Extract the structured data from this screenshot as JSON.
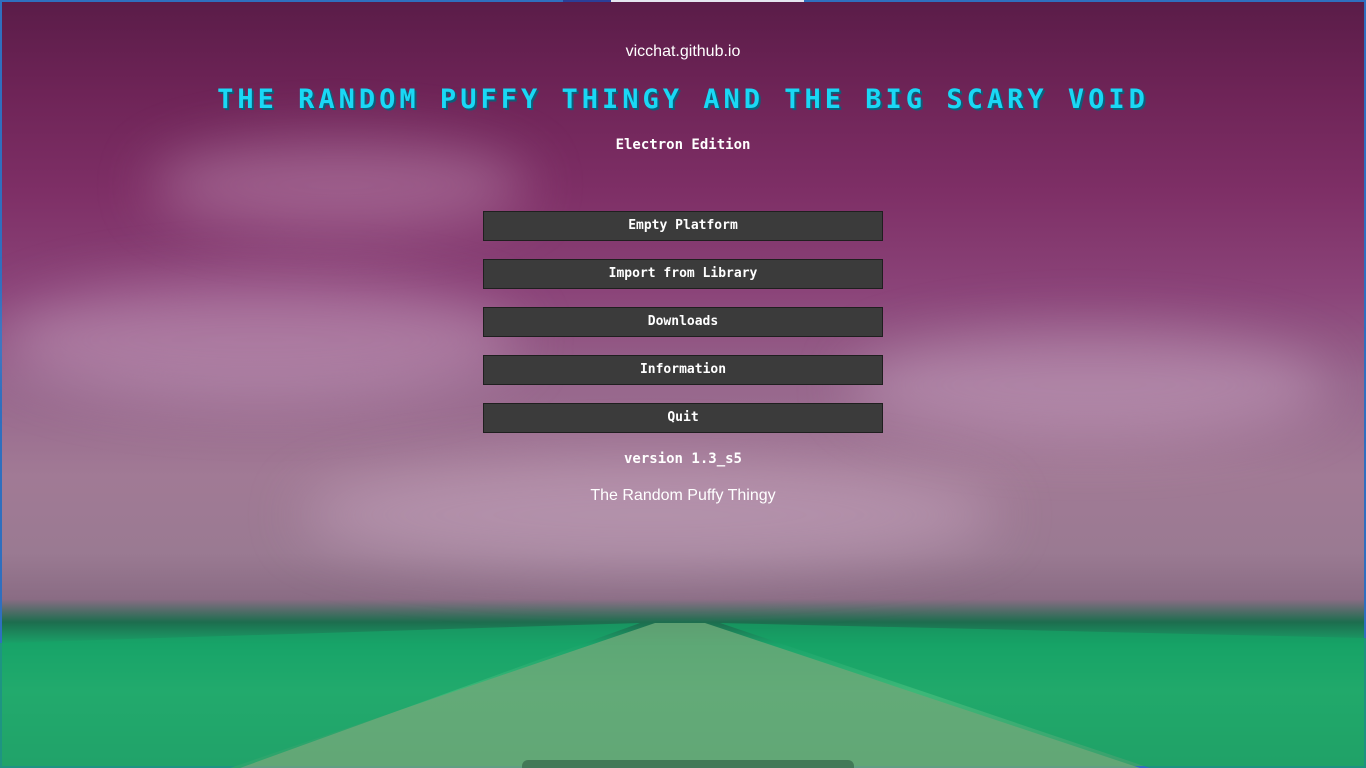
{
  "header": {
    "site": "vicchat.github.io",
    "title": "THE RANDOM PUFFY THINGY AND THE BIG SCARY VOID",
    "subtitle": "Electron Edition"
  },
  "menu": {
    "items": [
      {
        "label": "Empty Platform"
      },
      {
        "label": "Import from Library"
      },
      {
        "label": "Downloads"
      },
      {
        "label": "Information"
      },
      {
        "label": "Quit"
      }
    ]
  },
  "footer": {
    "version": "version 1.3_s5",
    "credit": "The Random Puffy Thingy"
  },
  "colors": {
    "title": "#1ad8f5",
    "button_bg": "#3b3b3b",
    "sky_top": "#5a1c48",
    "grass": "#1aa56a"
  }
}
